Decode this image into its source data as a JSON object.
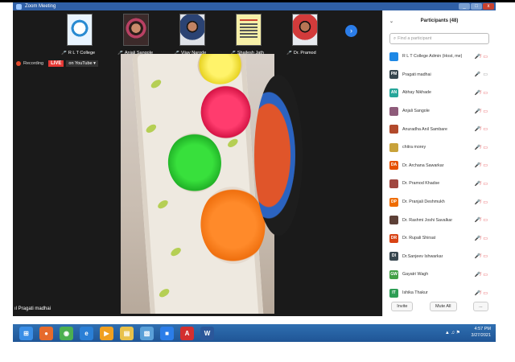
{
  "window": {
    "title": "Zoom Meeting",
    "controls": [
      "_",
      "□",
      "x"
    ]
  },
  "thumbnails": [
    {
      "name": "R L T College",
      "avatar": "logo"
    },
    {
      "name": "Anjali Sangole",
      "avatar": "woman"
    },
    {
      "name": "Vijay Narode",
      "avatar": "man1"
    },
    {
      "name": "Shailesh Jath",
      "avatar": "doc"
    },
    {
      "name": "Dr. Pramod",
      "avatar": "man2"
    }
  ],
  "recording": {
    "label": "Recording",
    "live_badge": "LIVE",
    "stream_label": "on YouTube ▾"
  },
  "self_view_name": "Pragati madhai",
  "participants_panel": {
    "title": "Participants (48)",
    "search_placeholder": "Find a participant",
    "invite_label": "Invite",
    "mute_all_label": "Mute All",
    "more_label": "...",
    "participants": [
      {
        "initials": "",
        "name": "R L T College Admin (Host, me)",
        "color": "#1e88e5",
        "mic_muted": true,
        "video_off": true
      },
      {
        "initials": "PM",
        "name": "Pragati madhai",
        "color": "#37474f",
        "mic_muted": false,
        "video_off": false
      },
      {
        "initials": "AN",
        "name": "Abhay Nikhade",
        "color": "#26a69a",
        "mic_muted": true,
        "video_off": true
      },
      {
        "initials": "",
        "name": "Anjali Sangole",
        "color": "#8e5b7a",
        "mic_muted": true,
        "video_off": true
      },
      {
        "initials": "",
        "name": "Anuradha Anil Sambare",
        "color": "#b24a2c",
        "mic_muted": true,
        "video_off": true
      },
      {
        "initials": "",
        "name": "chitra morey",
        "color": "#c8a23a",
        "mic_muted": true,
        "video_off": true
      },
      {
        "initials": "DA",
        "name": "Dr. Archana Sawarkar",
        "color": "#e65100",
        "mic_muted": true,
        "video_off": true
      },
      {
        "initials": "",
        "name": "Dr. Pramod Khadse",
        "color": "#a0463f",
        "mic_muted": true,
        "video_off": true
      },
      {
        "initials": "DP",
        "name": "Dr. Pranjali Deshmukh",
        "color": "#ef6c00",
        "mic_muted": true,
        "video_off": true
      },
      {
        "initials": "",
        "name": "Dr. Rashmi Joshi Savalkar",
        "color": "#5d4037",
        "mic_muted": true,
        "video_off": true
      },
      {
        "initials": "DR",
        "name": "Dr. Rupali Shirsat",
        "color": "#d84315",
        "mic_muted": true,
        "video_off": true
      },
      {
        "initials": "DI",
        "name": "Dr.Sanjeev Ishwarkar",
        "color": "#37474f",
        "mic_muted": true,
        "video_off": true
      },
      {
        "initials": "GW",
        "name": "Gayatri Wagh",
        "color": "#43a047",
        "mic_muted": true,
        "video_off": true
      },
      {
        "initials": "IT",
        "name": "Ishika Thakur",
        "color": "#2e9e55",
        "mic_muted": true,
        "video_off": true
      }
    ]
  },
  "taskbar": {
    "apps": [
      {
        "name": "start",
        "glyph": "⊞",
        "color": "#3a8ee6"
      },
      {
        "name": "firefox",
        "glyph": "●",
        "color": "#e66a2c"
      },
      {
        "name": "chrome",
        "glyph": "◉",
        "color": "#4caf50"
      },
      {
        "name": "ie",
        "glyph": "e",
        "color": "#2a7fd6"
      },
      {
        "name": "media",
        "glyph": "▶",
        "color": "#f0a020"
      },
      {
        "name": "explorer",
        "glyph": "▤",
        "color": "#e8c14a"
      },
      {
        "name": "photos",
        "glyph": "▧",
        "color": "#5aa0d8"
      },
      {
        "name": "zoom",
        "glyph": "■",
        "color": "#2b7de9"
      },
      {
        "name": "acrobat",
        "glyph": "A",
        "color": "#d32f2f"
      },
      {
        "name": "word",
        "glyph": "W",
        "color": "#2b579a"
      }
    ],
    "time": "4:57 PM",
    "date": "3/27/2021",
    "tray": "▲ ♫ ⚑"
  }
}
